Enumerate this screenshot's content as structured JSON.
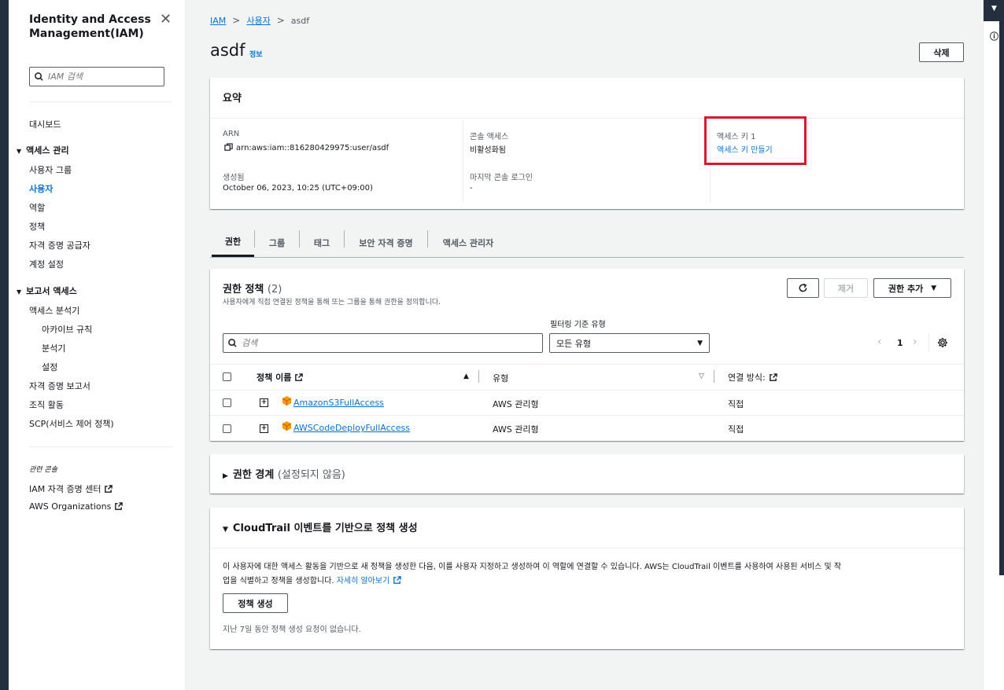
{
  "sidebar": {
    "title": "Identity and Access Management(IAM)",
    "search_placeholder": "IAM 검색",
    "dashboard": "대시보드",
    "access_mgmt": {
      "label": "액세스 관리",
      "items": [
        "사용자 그룹",
        "사용자",
        "역할",
        "정책",
        "자격 증명 공급자",
        "계정 설정"
      ]
    },
    "report_access": {
      "label": "보고서 액세스",
      "items": [
        "액세스 분석기",
        "아카이브 규칙",
        "분석기",
        "설정",
        "자격 증명 보고서",
        "조직 활동",
        "SCP(서비스 제어 정책)"
      ]
    },
    "related_label": "관련 콘솔",
    "related": [
      "IAM 자격 증명 센터",
      "AWS Organizations"
    ]
  },
  "breadcrumb": {
    "root": "IAM",
    "users": "사용자",
    "current": "asdf"
  },
  "page": {
    "title": "asdf",
    "info": "정보",
    "delete_button": "삭제"
  },
  "summary": {
    "heading": "요약",
    "arn_label": "ARN",
    "arn_value": "arn:aws:iam::816280429975:user/asdf",
    "created_label": "생성됨",
    "created_value": "October 06, 2023, 10:25 (UTC+09:00)",
    "console_access_label": "콘솔 액세스",
    "console_access_value": "비활성화됨",
    "last_login_label": "마지막 콘솔 로그인",
    "last_login_value": "-",
    "access_key_label": "액세스 키 1",
    "access_key_link": "액세스 키 만들기"
  },
  "tabs": [
    "권한",
    "그룹",
    "태그",
    "보안 자격 증명",
    "액세스 관리자"
  ],
  "permissions": {
    "heading": "권한 정책",
    "count": "(2)",
    "description": "사용자에게 직접 연결된 정책을 통해 또는 그룹을 통해 권한을 정의합니다.",
    "remove_button": "제거",
    "add_button": "권한 추가",
    "filter_label": "필터링 기준 유형",
    "search_placeholder": "검색",
    "filter_value": "모든 유형",
    "page_number": "1",
    "columns": {
      "name": "정책 이름",
      "type": "유형",
      "attached": "연결 방식:"
    },
    "rows": [
      {
        "name": "AmazonS3FullAccess",
        "type": "AWS 관리형",
        "attached": "직접"
      },
      {
        "name": "AWSCodeDeployFullAccess",
        "type": "AWS 관리형",
        "attached": "직접"
      }
    ]
  },
  "boundary": {
    "heading": "권한 경계",
    "status": "(설정되지 않음)"
  },
  "cloudtrail": {
    "heading": "CloudTrail 이벤트를 기반으로 정책 생성",
    "line1": "이 사용자에 대한 액세스 활동을 기반으로 새 정책을 생성한 다음, 이를 사용자 지정하고 생성하여 이 역할에 연결할 수 있습니다. AWS는 CloudTrail 이벤트를 사용하여 사용된 서비스 및 작",
    "line2": "업을 식별하고 정책을 생성합니다.",
    "learn_more": "자세히 알아보기",
    "button": "정책 생성",
    "note": "지난 7일 동안 정책 생성 요청이 없습니다."
  },
  "colors": {
    "link": "#0972d3",
    "highlight": "#e0152b",
    "nav_dark": "#232f3e"
  }
}
